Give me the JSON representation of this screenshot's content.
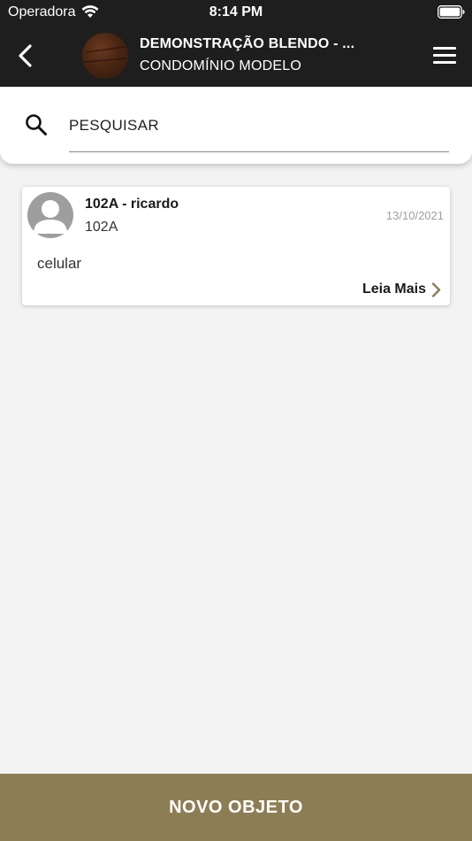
{
  "status_bar": {
    "carrier": "Operadora",
    "time": "8:14 PM",
    "wifi_icon": "wifi-icon",
    "battery_icon": "battery-icon"
  },
  "header": {
    "title": "DEMONSTRAÇÃO BLENDO - ...",
    "subtitle": "CONDOMÍNIO MODELO",
    "back_icon": "chevron-left-icon",
    "menu_icon": "hamburger-menu-icon"
  },
  "search": {
    "placeholder": "PESQUISAR",
    "value": "",
    "icon": "search-icon"
  },
  "items": [
    {
      "name": "102A - ricardo",
      "unit": "102A",
      "date": "13/10/2021",
      "description": "celular",
      "read_more": "Leia Mais"
    }
  ],
  "bottom_button": {
    "label": "NOVO OBJETO"
  },
  "colors": {
    "header_bg": "#1e1e1e",
    "accent": "#8d7d55",
    "background": "#f3f3f3"
  }
}
